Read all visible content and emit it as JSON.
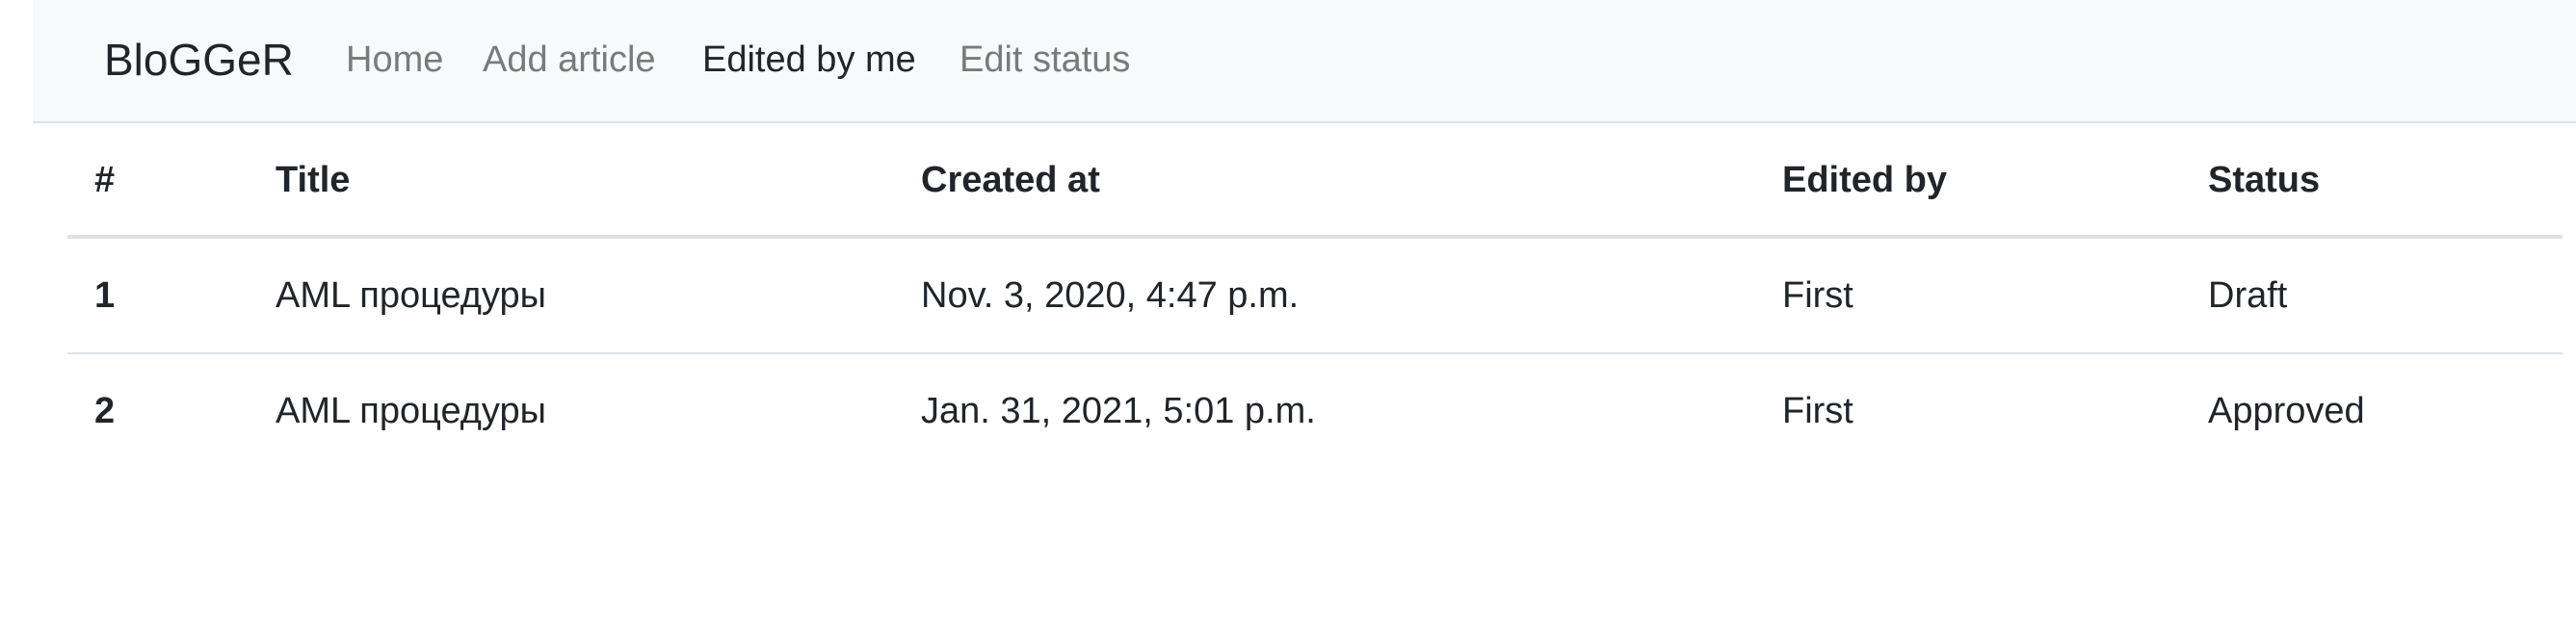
{
  "navbar": {
    "brand": "BloGGeR",
    "links": [
      {
        "label": "Home",
        "active": false
      },
      {
        "label": "Add article",
        "active": false
      },
      {
        "label": "Edited by me",
        "active": true
      },
      {
        "label": "Edit status",
        "active": false
      }
    ]
  },
  "table": {
    "headers": [
      "#",
      "Title",
      "Created at",
      "Edited by",
      "Status"
    ],
    "rows": [
      [
        "1",
        "AML процедуры",
        "Nov. 3, 2020, 4:47 p.m.",
        "First",
        "Draft"
      ],
      [
        "2",
        "AML процедуры",
        "Jan. 31, 2021, 5:01 p.m.",
        "First",
        "Approved"
      ]
    ]
  },
  "colors": {
    "navbar_bg": "#f8f9fa",
    "border": "#dee2e6",
    "text": "#212529",
    "muted_link": "#7a7a7a"
  }
}
